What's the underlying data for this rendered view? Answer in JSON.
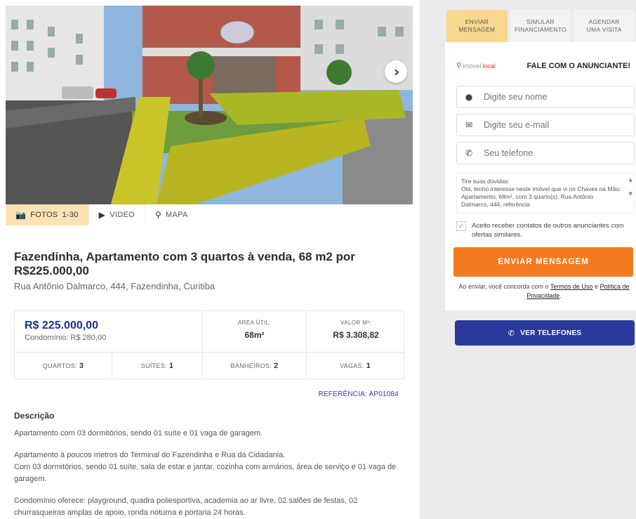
{
  "gallery": {
    "next_icon": "chevron-right-icon",
    "tabs": [
      {
        "icon": "camera-icon",
        "label": "FOTOS",
        "count": "1-30"
      },
      {
        "icon": "play-icon",
        "label": "VIDEO"
      },
      {
        "icon": "map-pin-icon",
        "label": "MAPA"
      }
    ]
  },
  "listing": {
    "title": "Fazendinha, Apartamento com 3 quartos à venda, 68 m2 por R$225.000,00",
    "address": "Rua Antônio Dalmarco, 444, Fazendinha, Curitiba",
    "price": "R$ 225.000,00",
    "condo": "Condomínio: R$ 280,00",
    "area_label": "ÁREA ÚTIL:",
    "area_value": "68m²",
    "sqm_label": "VALOR M²:",
    "sqm_value": "R$ 3.308,82",
    "features": [
      {
        "label": "QUARTOS:",
        "value": "3"
      },
      {
        "label": "SUÍTES:",
        "value": "1"
      },
      {
        "label": "BANHEIROS:",
        "value": "2"
      },
      {
        "label": "VAGAS:",
        "value": "1"
      }
    ],
    "reference": "REFERÊNCIA: AP01084"
  },
  "description": {
    "title": "Descrição",
    "paragraphs": [
      "Apartamento com 03 dormitórios, sendo 01 suíte e 01 vaga de garagem.",
      "Apartamento à poucos metros do Terminal do Fazendinha e Rua da Cidadania.",
      "Com 03 dormitórios, sendo 01 suíte, sala de estar e jantar, cozinha com armários, área de serviço e 01 vaga de garagem.",
      "Condomínio oferece: playground, quadra poliesportiva, academia ao ar livre, 02 salões de festas, 02 churrasqueiras amplas de apoio, ronda noturna e portaria 24 horas."
    ]
  },
  "contact": {
    "tabs": [
      {
        "line1": "ENVIAR",
        "line2": "MENSAGEM",
        "active": true
      },
      {
        "line1": "SIMULAR",
        "line2": "FINANCIAMENTO",
        "active": false
      },
      {
        "line1": "AGENDAR",
        "line2": "UMA VISITA",
        "active": false
      }
    ],
    "brand_a": "imóvel",
    "brand_b": "local",
    "heading": "FALE COM O ANUNCIANTE!",
    "name_placeholder": "Digite seu nome",
    "email_placeholder": "Digite seu e-mail",
    "phone_placeholder": "Seu telefone",
    "message_label": "Tire suas dúvidas:",
    "message_text": "Olá, tenho interesse neste imóvel que vi no Chaves na Mão: Apartamento, 68m², com 3 quarto(s), Rua Antônio Dalmarco, 444, referência",
    "consent": "Aceito receber contatos de outros anunciantes com ofertas similares.",
    "send_label": "ENVIAR MENSAGEM",
    "terms_prefix": "Ao enviar, você concorda com o",
    "terms_link": "Termos de Uso",
    "terms_and": "e",
    "privacy_link": "Política de Privacidade",
    "terms_suffix": ".",
    "phones_label": "VER TELEFONES"
  },
  "colors": {
    "price": "#1e2f8c",
    "send_button": "#f47a20",
    "phones_button": "#2b3a9a",
    "active_tab": "#f8d88f"
  }
}
